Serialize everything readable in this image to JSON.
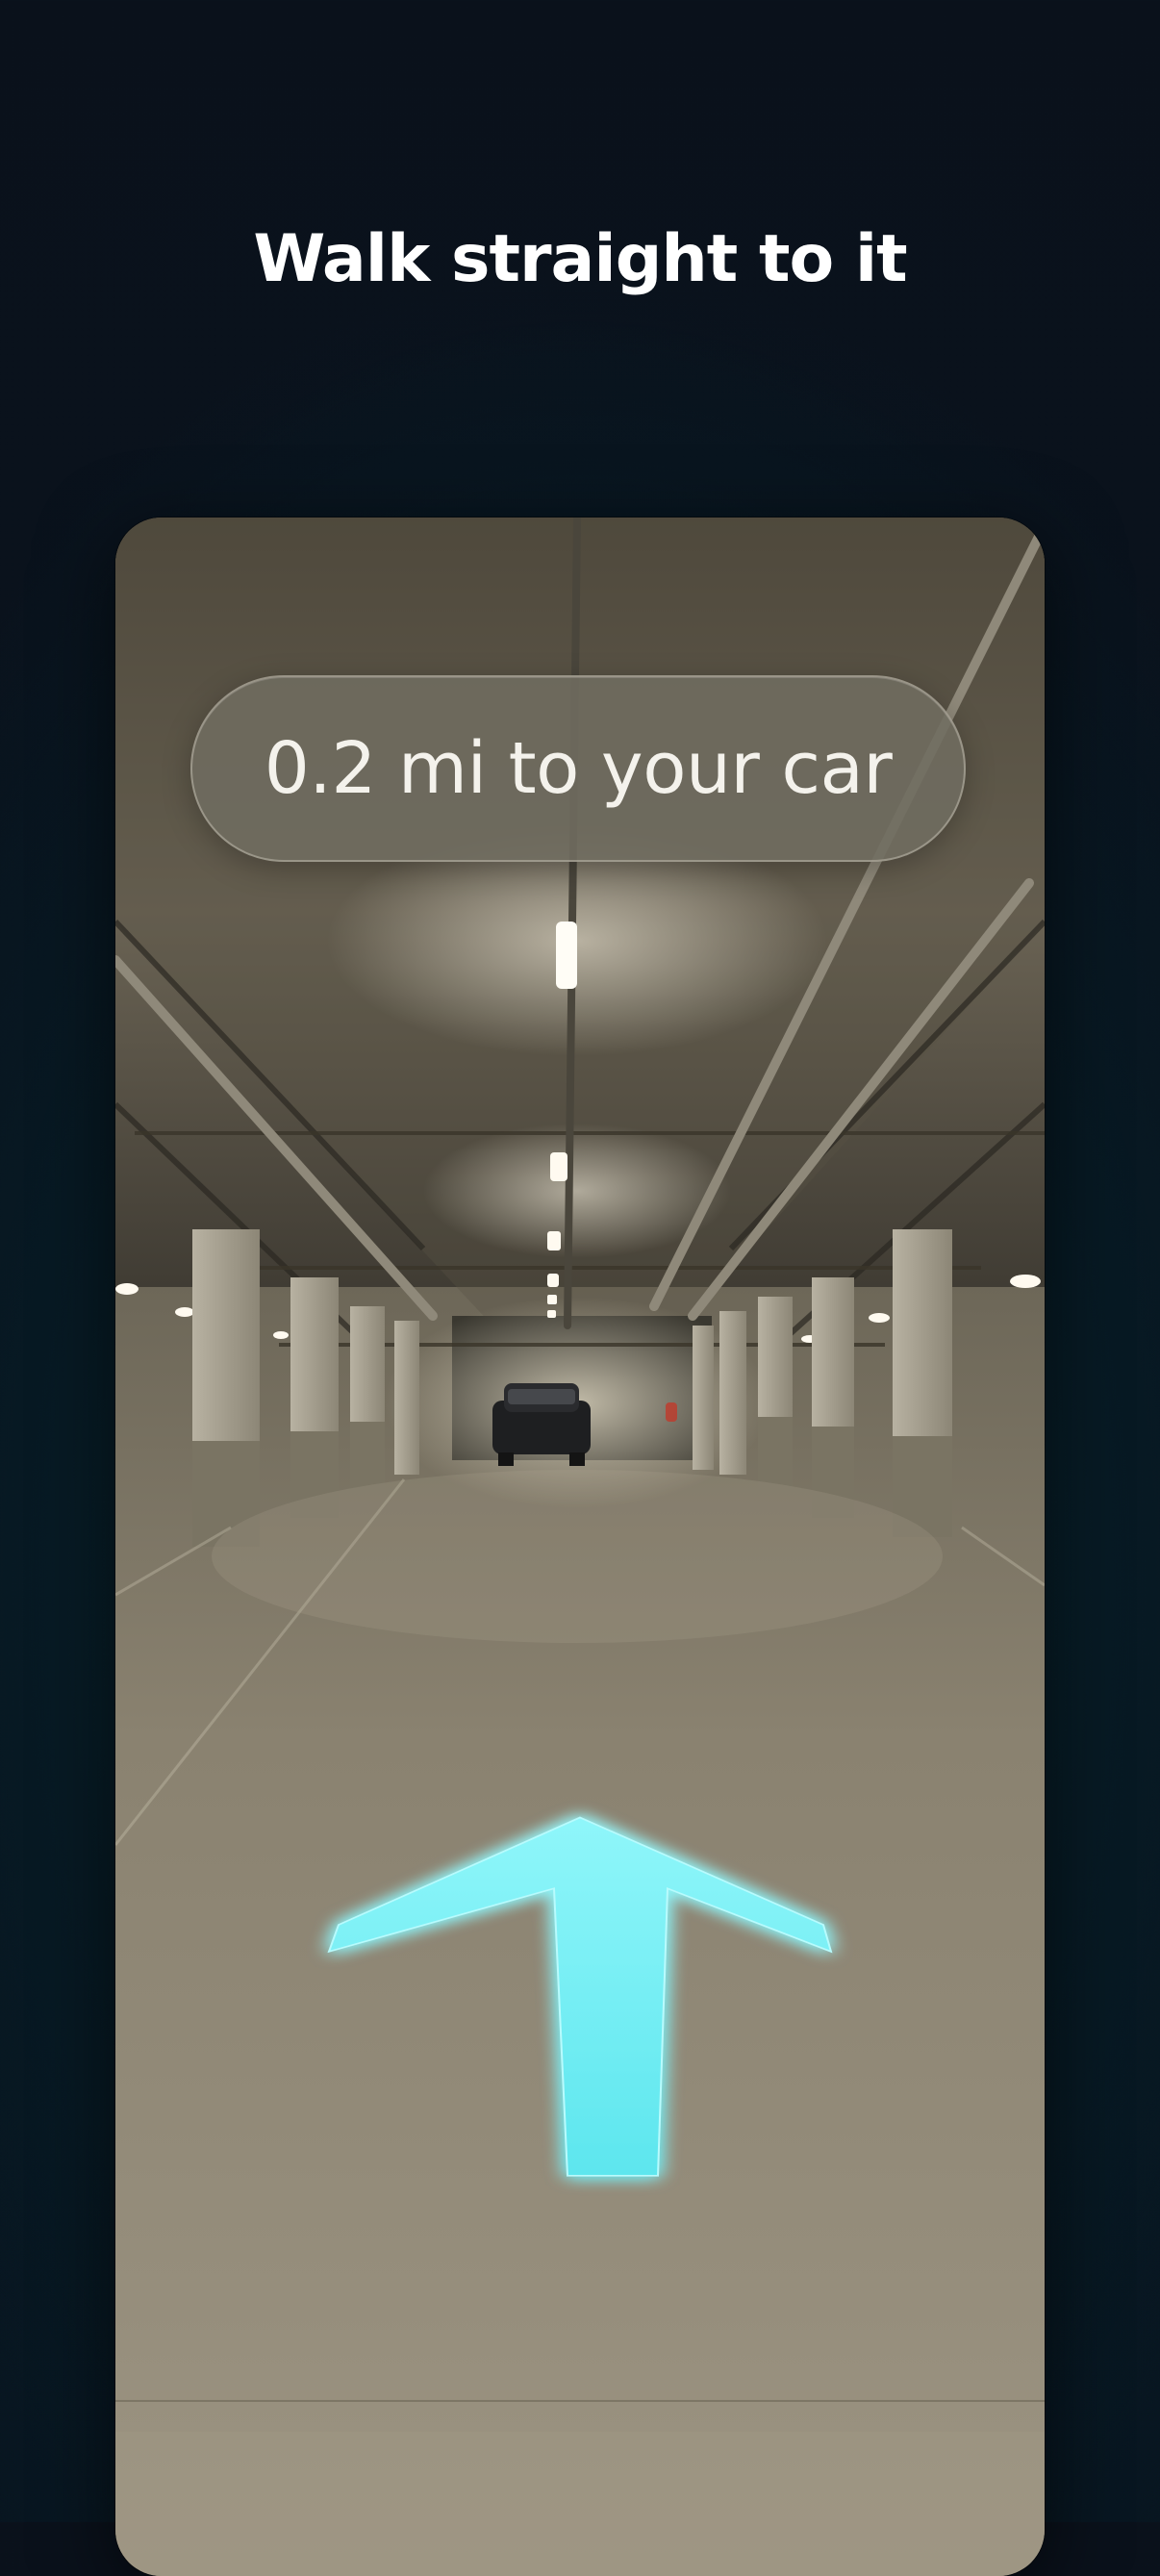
{
  "headline": "Walk straight to it",
  "ar_view": {
    "distance_label": "0.2 mi to your car",
    "direction_icon": "arrow-up-icon",
    "arrow_color": "#6ff0f4"
  },
  "colors": {
    "background": "#081520",
    "background_glow": "#0b3542",
    "headline_text": "#ffffff",
    "pill_text": "#f4f2ec"
  }
}
